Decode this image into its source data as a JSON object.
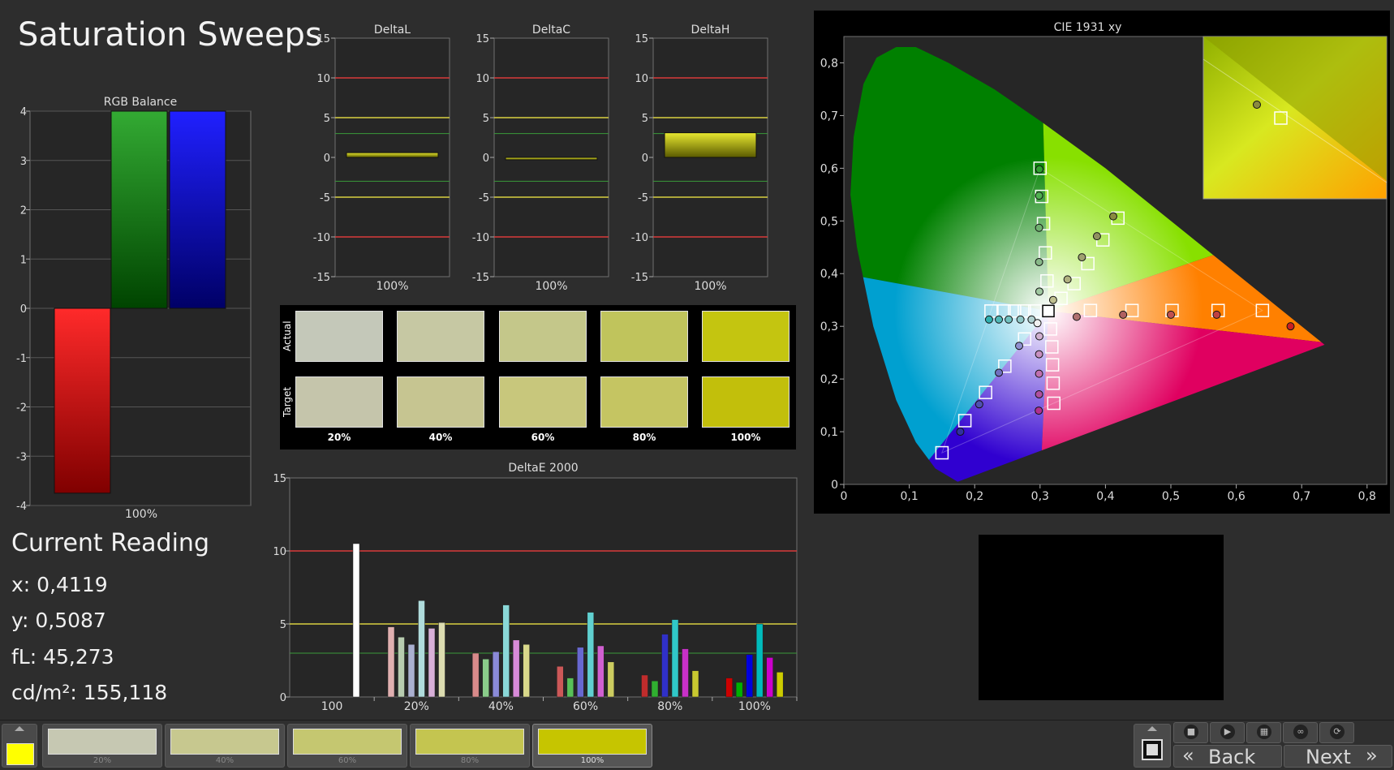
{
  "page_title": "Saturation Sweeps",
  "current_reading": {
    "title": "Current Reading",
    "x": "x: 0,4119",
    "y": "y: 0,5087",
    "fl": "fL: 45,273",
    "cdm2": "cd/m²: 155,118"
  },
  "swatches": {
    "row_labels": [
      "Actual",
      "Target"
    ],
    "labels": [
      "20%",
      "40%",
      "60%",
      "80%",
      "100%"
    ],
    "actual_colors": [
      "#c4c8b9",
      "#c6c8a3",
      "#c4c78a",
      "#c0c45c",
      "#c4c510"
    ],
    "target_colors": [
      "#c5c5ab",
      "#c6c591",
      "#c8c77c",
      "#c5c562",
      "#c2bf0b"
    ]
  },
  "colors": {
    "red_limit": "#d83a3a",
    "yellow_limit": "#d8d040",
    "green_limit": "#3a9a3a",
    "panel": "#262626",
    "grid": "#707070"
  },
  "bottom_bar": {
    "current_color": "#ffff00",
    "thumbnails": [
      {
        "label": "20%",
        "color": "#c6c8b2"
      },
      {
        "label": "40%",
        "color": "#c7c88f"
      },
      {
        "label": "60%",
        "color": "#c5c770"
      },
      {
        "label": "80%",
        "color": "#c4c550"
      },
      {
        "label": "100%",
        "color": "#c6c500"
      }
    ],
    "back_label": "Back",
    "next_label": "Next",
    "media_icons": [
      "stop-icon",
      "play-icon",
      "film-icon",
      "loop-icon",
      "refresh-icon"
    ]
  },
  "chart_data": [
    {
      "type": "bar",
      "title": "RGB Balance",
      "categories": [
        "100%"
      ],
      "series": [
        {
          "color": "#ff0000",
          "values": [
            -3.75
          ]
        },
        {
          "color": "#009900",
          "values": [
            4
          ]
        },
        {
          "color": "#0000ff",
          "values": [
            4
          ]
        }
      ],
      "yticks": [
        4,
        3,
        2,
        1,
        0,
        -1,
        -2,
        -3,
        -4
      ],
      "ylim": [
        -4,
        4
      ],
      "xlabel": "",
      "ylabel": ""
    },
    {
      "type": "bar",
      "title": "DeltaL",
      "categories": [
        "100%"
      ],
      "values": [
        0.6
      ],
      "yticks": [
        15,
        10,
        5,
        0,
        -5,
        -10,
        -15
      ],
      "ylim": [
        -15,
        15
      ],
      "limits": {
        "red": [
          10,
          -10
        ],
        "yellow": [
          5,
          -5
        ],
        "green": [
          3,
          -3
        ]
      }
    },
    {
      "type": "bar",
      "title": "DeltaC",
      "categories": [
        "100%"
      ],
      "values": [
        -0.3
      ],
      "yticks": [
        15,
        10,
        5,
        0,
        -5,
        -10,
        -15
      ],
      "ylim": [
        -15,
        15
      ],
      "limits": {
        "red": [
          10,
          -10
        ],
        "yellow": [
          5,
          -5
        ],
        "green": [
          3,
          -3
        ]
      }
    },
    {
      "type": "bar",
      "title": "DeltaH",
      "categories": [
        "100%"
      ],
      "values": [
        3.1
      ],
      "yticks": [
        15,
        10,
        5,
        0,
        -5,
        -10,
        -15
      ],
      "ylim": [
        -15,
        15
      ],
      "limits": {
        "red": [
          10,
          -10
        ],
        "yellow": [
          5,
          -5
        ],
        "green": [
          3,
          -3
        ]
      }
    },
    {
      "type": "bar",
      "title": "DeltaE 2000",
      "categories": [
        "100",
        "20%",
        "40%",
        "60%",
        "80%",
        "100%"
      ],
      "groups": [
        {
          "label": "100",
          "values": [
            10.5
          ],
          "colors": [
            "#ffffff"
          ]
        },
        {
          "label": "20%",
          "values": [
            4.8,
            4.1,
            3.6,
            6.6,
            4.7,
            5.1
          ],
          "colors": [
            "#e0b0b0",
            "#b8ccb0",
            "#aab0d0",
            "#b0dcdc",
            "#d8b0d8",
            "#dcdcb0"
          ]
        },
        {
          "label": "40%",
          "values": [
            3.0,
            2.6,
            3.1,
            6.3,
            3.9,
            3.6
          ],
          "colors": [
            "#d88a8a",
            "#8acc8a",
            "#8a8ad8",
            "#8ad8d8",
            "#d88ad8",
            "#d8d88a"
          ]
        },
        {
          "label": "60%",
          "values": [
            2.1,
            1.3,
            3.4,
            5.8,
            3.5,
            2.4
          ],
          "colors": [
            "#cc5858",
            "#58c058",
            "#6868d0",
            "#60d0d0",
            "#d060d0",
            "#cccc60"
          ]
        },
        {
          "label": "80%",
          "values": [
            1.5,
            1.1,
            4.3,
            5.3,
            3.3,
            1.8
          ],
          "colors": [
            "#c02c2c",
            "#30b030",
            "#3030c8",
            "#30c8c8",
            "#c830c8",
            "#c8c830"
          ]
        },
        {
          "label": "100%",
          "values": [
            1.3,
            1.0,
            2.9,
            5.0,
            2.7,
            1.7
          ],
          "colors": [
            "#cc0000",
            "#00b000",
            "#0000dd",
            "#00bbbb",
            "#cc00cc",
            "#cccc00"
          ]
        }
      ],
      "yticks": [
        15,
        10,
        5,
        0
      ],
      "ylim": [
        0,
        15
      ],
      "limits": {
        "red": 10,
        "yellow": 5,
        "green": 3
      }
    },
    {
      "type": "scatter",
      "title": "CIE 1931 xy",
      "xticks": [
        "0",
        "0,1",
        "0,2",
        "0,3",
        "0,4",
        "0,5",
        "0,6",
        "0,7",
        "0,8"
      ],
      "yticks": [
        "0",
        "0,1",
        "0,2",
        "0,3",
        "0,4",
        "0,5",
        "0,6",
        "0,7",
        "0,8"
      ],
      "xlim": [
        0,
        0.83
      ],
      "ylim": [
        0,
        0.85
      ],
      "gamut": [
        [
          0.64,
          0.33
        ],
        [
          0.3,
          0.6
        ],
        [
          0.15,
          0.06
        ]
      ],
      "targets": [
        [
          0.3127,
          0.329
        ],
        [
          0.64,
          0.33
        ],
        [
          0.5722,
          0.33
        ],
        [
          0.5018,
          0.33
        ],
        [
          0.4405,
          0.33
        ],
        [
          0.377,
          0.33
        ],
        [
          0.3,
          0.6
        ],
        [
          0.3025,
          0.5465
        ],
        [
          0.3053,
          0.4949
        ],
        [
          0.3081,
          0.4393
        ],
        [
          0.3106,
          0.3861
        ],
        [
          0.15,
          0.06
        ],
        [
          0.185,
          0.121
        ],
        [
          0.2167,
          0.1745
        ],
        [
          0.2461,
          0.2244
        ],
        [
          0.2764,
          0.276
        ],
        [
          0.225,
          0.329
        ],
        [
          0.245,
          0.329
        ],
        [
          0.261,
          0.329
        ],
        [
          0.276,
          0.329
        ],
        [
          0.292,
          0.329
        ],
        [
          0.419,
          0.5053
        ],
        [
          0.396,
          0.464
        ],
        [
          0.373,
          0.419
        ],
        [
          0.352,
          0.381
        ],
        [
          0.332,
          0.353
        ],
        [
          0.321,
          0.154
        ],
        [
          0.32,
          0.192
        ],
        [
          0.319,
          0.227
        ],
        [
          0.318,
          0.261
        ],
        [
          0.316,
          0.295
        ]
      ],
      "measured": [
        {
          "x": 0.683,
          "y": 0.3,
          "c": "#cc2020"
        },
        {
          "x": 0.57,
          "y": 0.322,
          "c": "#c04040"
        },
        {
          "x": 0.5,
          "y": 0.322,
          "c": "#c05050"
        },
        {
          "x": 0.427,
          "y": 0.322,
          "c": "#b06060"
        },
        {
          "x": 0.356,
          "y": 0.318,
          "c": "#b07070"
        },
        {
          "x": 0.299,
          "y": 0.598,
          "c": "#30a030"
        },
        {
          "x": 0.2985,
          "y": 0.548,
          "c": "#50b050"
        },
        {
          "x": 0.2985,
          "y": 0.487,
          "c": "#70b070"
        },
        {
          "x": 0.2985,
          "y": 0.422,
          "c": "#88b888"
        },
        {
          "x": 0.299,
          "y": 0.366,
          "c": "#a0c8a0"
        },
        {
          "x": 0.178,
          "y": 0.1,
          "c": "#3030a0"
        },
        {
          "x": 0.207,
          "y": 0.152,
          "c": "#5050b0"
        },
        {
          "x": 0.237,
          "y": 0.212,
          "c": "#7070c0"
        },
        {
          "x": 0.268,
          "y": 0.263,
          "c": "#9090d0"
        },
        {
          "x": 0.222,
          "y": 0.313,
          "c": "#30b0b0"
        },
        {
          "x": 0.237,
          "y": 0.313,
          "c": "#50b8b8"
        },
        {
          "x": 0.252,
          "y": 0.313,
          "c": "#70c0c0"
        },
        {
          "x": 0.27,
          "y": 0.313,
          "c": "#90c8c8"
        },
        {
          "x": 0.287,
          "y": 0.313,
          "c": "#b0d0d0"
        },
        {
          "x": 0.4119,
          "y": 0.5087,
          "c": "#8a8a40"
        },
        {
          "x": 0.387,
          "y": 0.471,
          "c": "#909060"
        },
        {
          "x": 0.364,
          "y": 0.431,
          "c": "#a0a070"
        },
        {
          "x": 0.342,
          "y": 0.389,
          "c": "#b0b080"
        },
        {
          "x": 0.32,
          "y": 0.35,
          "c": "#c0c090"
        },
        {
          "x": 0.298,
          "y": 0.14,
          "c": "#b03090"
        },
        {
          "x": 0.2985,
          "y": 0.171,
          "c": "#b050a0"
        },
        {
          "x": 0.2985,
          "y": 0.21,
          "c": "#c070b0"
        },
        {
          "x": 0.2985,
          "y": 0.247,
          "c": "#c890c0"
        },
        {
          "x": 0.299,
          "y": 0.281,
          "c": "#d0b0d0"
        },
        {
          "x": 0.296,
          "y": 0.306,
          "c": "#f0f0f0"
        }
      ],
      "inset": {
        "measured": [
          0.4119,
          0.5087
        ],
        "target": [
          0.419,
          0.5053
        ]
      }
    }
  ]
}
